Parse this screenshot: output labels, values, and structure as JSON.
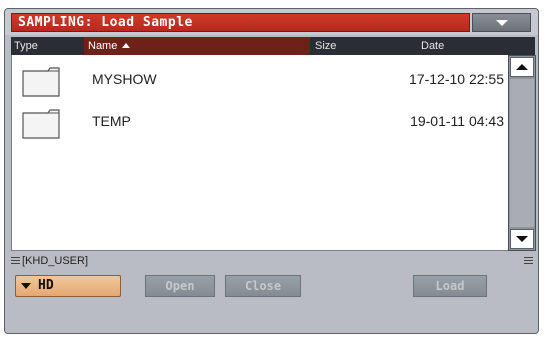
{
  "window": {
    "title": "SAMPLING: Load Sample",
    "menu_icon": "chevron-down-icon"
  },
  "columns": {
    "type": "Type",
    "name": "Name",
    "size": "Size",
    "date": "Date",
    "sort": "ascending"
  },
  "files": [
    {
      "icon": "folder-icon",
      "name": "MYSHOW",
      "size": "",
      "date": "17-12-10 22:55"
    },
    {
      "icon": "folder-icon",
      "name": "TEMP",
      "size": "",
      "date": "19-01-11 04:43"
    }
  ],
  "path": "[KHD_USER]",
  "device": {
    "selected": "HD"
  },
  "buttons": {
    "open": "Open",
    "close": "Close",
    "load": "Load"
  },
  "colors": {
    "title_bg": "#c0301f",
    "sorted_column_bg": "#6e2118",
    "header_bg": "#2a2d33",
    "dropdown_bg": "#eab98a",
    "panel_bg": "#b9bcc3"
  }
}
